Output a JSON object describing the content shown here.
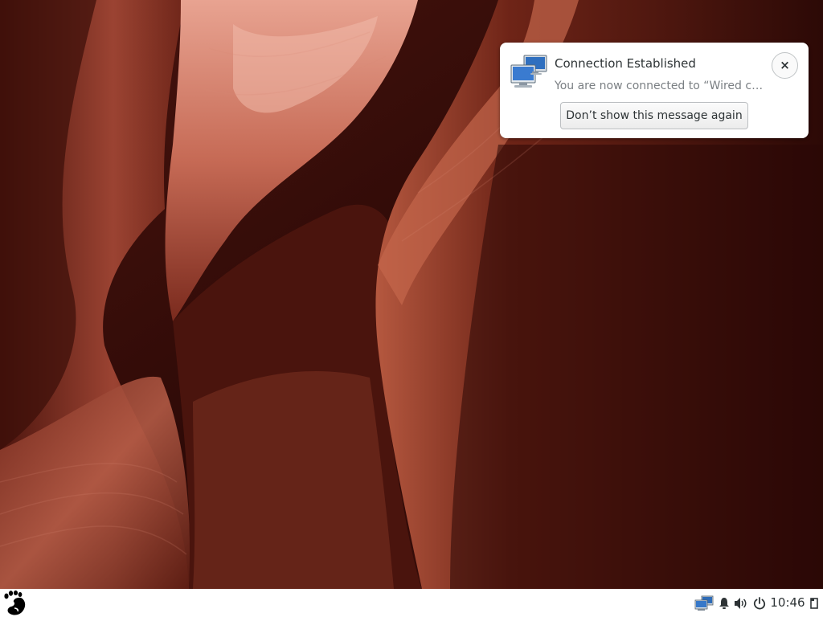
{
  "notification": {
    "icon": "network-wired-icon",
    "title": "Connection Established",
    "body": "You are now connected to “Wired conn…",
    "action_label": "Don’t show this message again",
    "close_symbol": "×"
  },
  "panel": {
    "launcher_icon": "gnome-foot-icon",
    "tray_icons": [
      "network-icon",
      "bell-icon",
      "volume-icon",
      "power-icon",
      "window-icon"
    ],
    "clock": "10:46"
  },
  "colors": {
    "panel_background": "#ffffff",
    "notification_background": "#ffffff",
    "wallpaper_dark": "#2a0805",
    "wallpaper_light": "#d98a76"
  }
}
